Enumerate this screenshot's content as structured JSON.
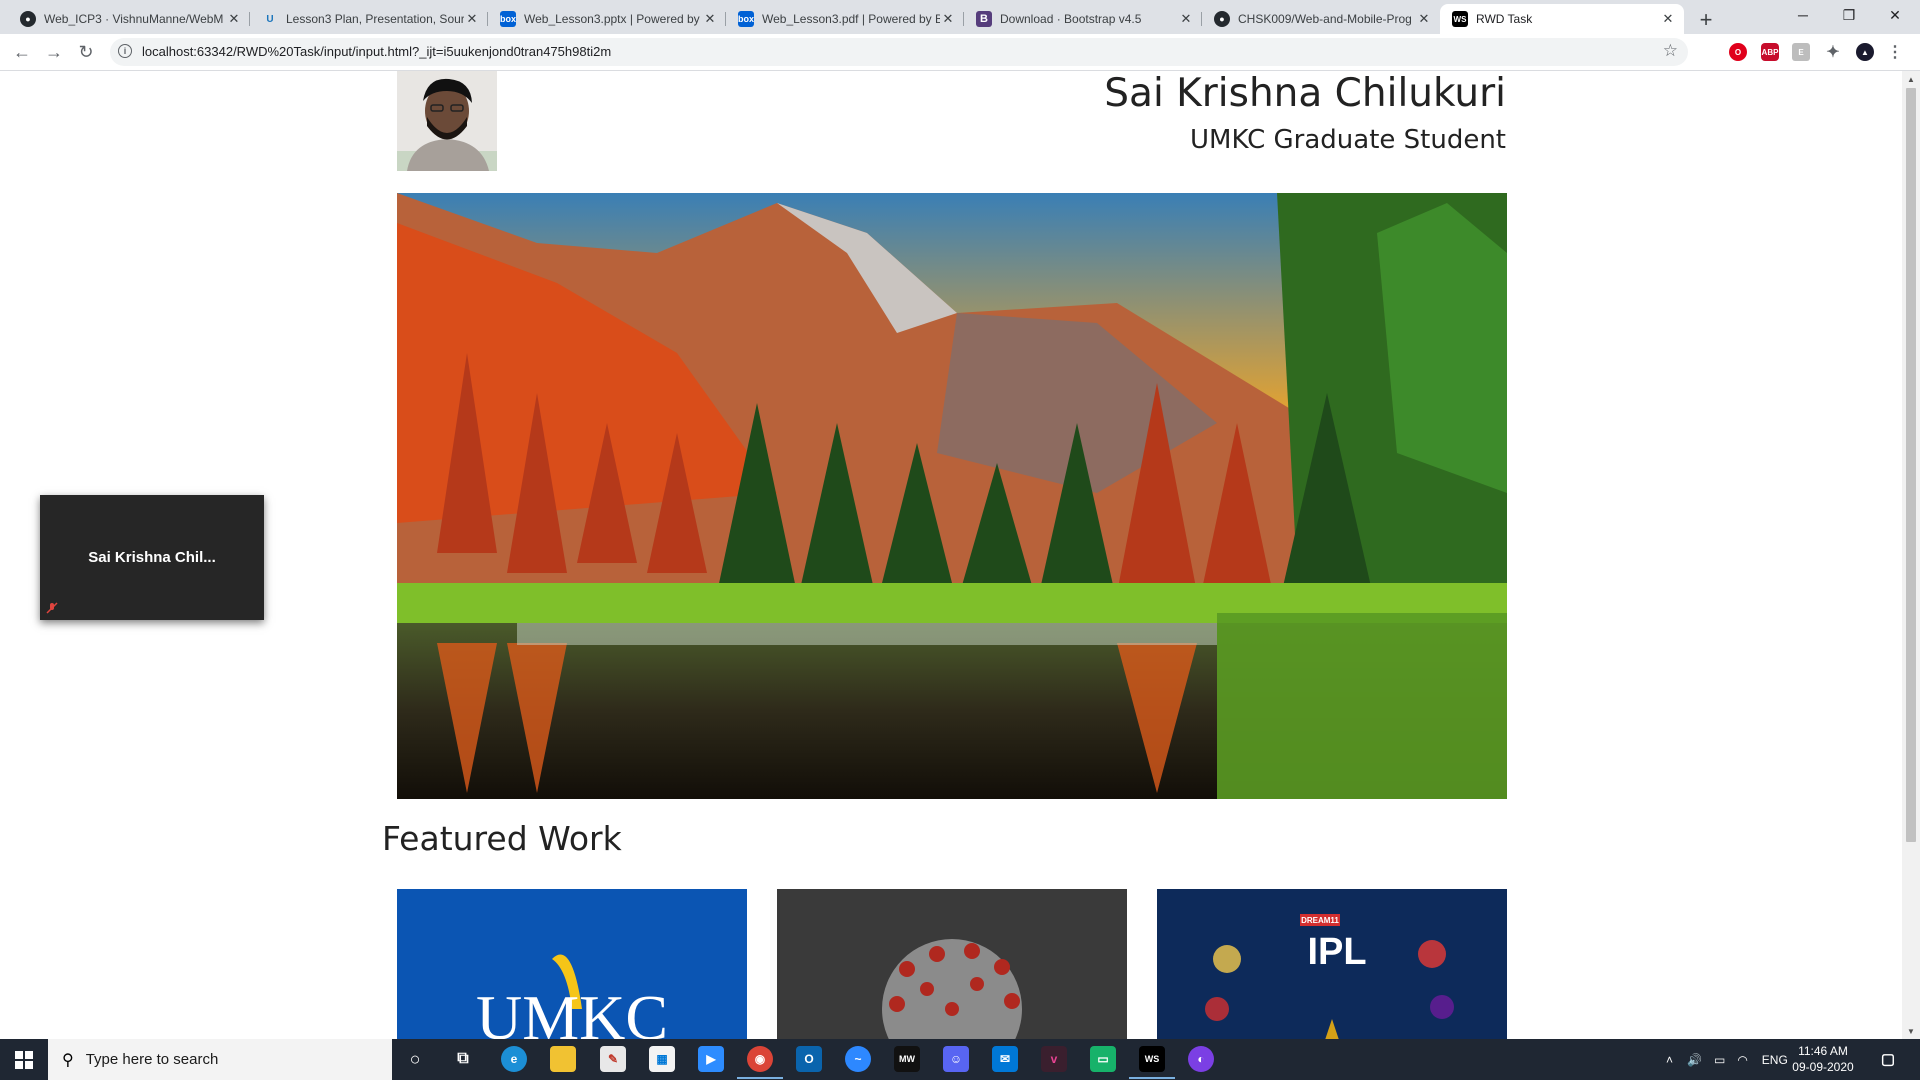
{
  "browser": {
    "tabs": [
      {
        "title": "Web_ICP3 · VishnuManne/WebM",
        "favicon": "github-icon",
        "active": false
      },
      {
        "title": "Lesson3 Plan, Presentation, Sourc",
        "favicon": "umkc-icon",
        "active": false
      },
      {
        "title": "Web_Lesson3.pptx | Powered by",
        "favicon": "box-icon",
        "active": false
      },
      {
        "title": "Web_Lesson3.pdf | Powered by B",
        "favicon": "box-icon",
        "active": false
      },
      {
        "title": "Download · Bootstrap v4.5",
        "favicon": "bootstrap-icon",
        "active": false
      },
      {
        "title": "CHSK009/Web-and-Mobile-Prog",
        "favicon": "github-icon",
        "active": false
      },
      {
        "title": "RWD Task",
        "favicon": "webstorm-icon",
        "active": true
      }
    ],
    "url": "localhost:63342/RWD%20Task/input/input.html?_ijt=i5uukenjond0tran475h98ti2m"
  },
  "page": {
    "name": "Sai Krishna Chilukuri",
    "subtitle": "UMKC Graduate Student",
    "featured_heading": "Featured Work",
    "cards": [
      {
        "alt": "UMKC",
        "text": "UMKC"
      },
      {
        "alt": "Coronavirus"
      },
      {
        "alt": "IPL",
        "text": "IPL",
        "badge": "DREAM11"
      }
    ]
  },
  "zoom_overlay": {
    "name": "Sai Krishna Chil..."
  },
  "taskbar": {
    "search_placeholder": "Type here to search",
    "tray_language": "ENG",
    "time": "11:46 AM",
    "date": "09-09-2020"
  }
}
